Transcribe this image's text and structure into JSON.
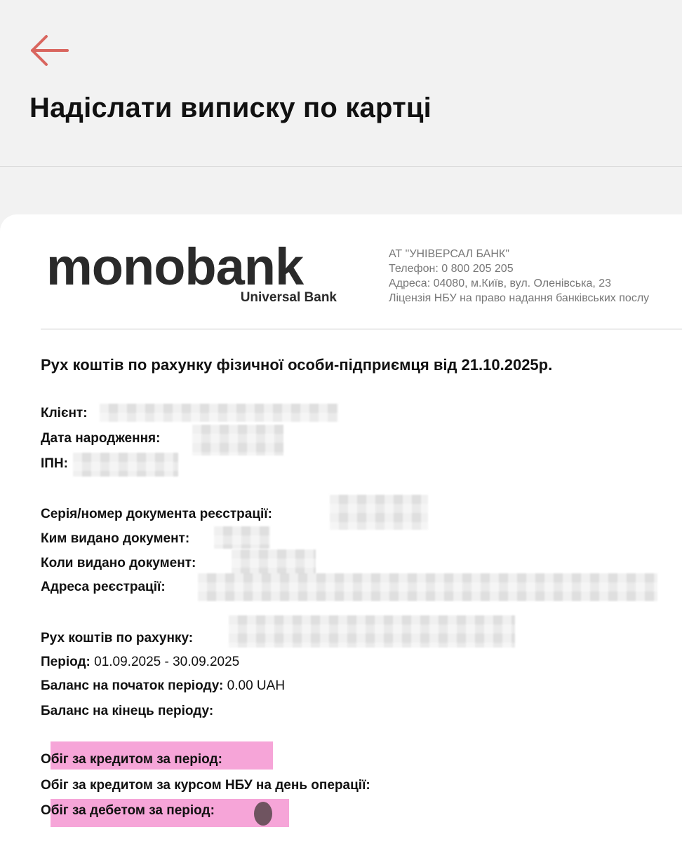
{
  "header": {
    "back_icon": "arrow-left-icon",
    "back_color": "#d9665f",
    "title": "Надіслати виписку по картці"
  },
  "document": {
    "logo": {
      "main": "monobank",
      "sub": "Universal Bank"
    },
    "bank_info": {
      "name": "АТ \"УНІВЕРСАЛ БАНК\"",
      "phone": "Телефон:  0 800 205 205",
      "address": "Адреса:  04080, м.Київ, вул. Оленівська, 23",
      "license": "Ліцензія НБУ на право надання банківських послу"
    },
    "title": "Рух коштів по рахунку фізичної особи-підприємця від 21.10.2025р.",
    "client": {
      "label": "Клієнт:",
      "value": ""
    },
    "birth_date": {
      "label": "Дата народження:",
      "value": ""
    },
    "ipn": {
      "label": "ІПН:",
      "value": ""
    },
    "reg_doc": {
      "label": "Серія/номер документа реєстрації:",
      "value": ""
    },
    "issued_by": {
      "label": "Ким видано документ:",
      "value": ""
    },
    "issued_when": {
      "label": "Коли видано документ:",
      "value": ""
    },
    "reg_address": {
      "label": "Адреса реєстрації:",
      "value": ""
    },
    "account": {
      "label": "Рух коштів по рахунку:",
      "value": ""
    },
    "period": {
      "label": "Період:",
      "value": "01.09.2025 - 30.09.2025"
    },
    "balance_start": {
      "label": "Баланс на початок періоду:",
      "value": "0.00 UAH"
    },
    "balance_end": {
      "label": "Баланс на кінець періоду:",
      "value": ""
    },
    "credit_turnover": {
      "label": "Обіг за кредитом за період:",
      "value": ""
    },
    "credit_turnover_nbu": {
      "label": "Обіг за кредитом за курсом НБУ на день операції:",
      "value": ""
    },
    "debit_turnover": {
      "label": "Обіг за дебетом за період:",
      "value": ""
    },
    "highlight_color": "#f6a5d8"
  }
}
